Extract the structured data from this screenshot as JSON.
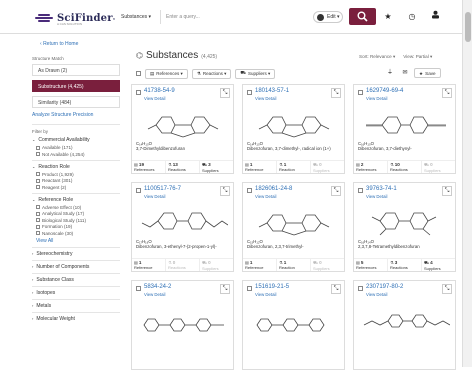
{
  "header": {
    "logo_text": "SciFinder",
    "logo_sup": "n",
    "logo_sub": "A CAS SOLUTION",
    "scope_label": "Substances ▾",
    "query_placeholder": "Enter a query...",
    "edit_label": "Edit ▾"
  },
  "nav": {
    "return_label": "Return to Home"
  },
  "sidebar": {
    "structure_match_heading": "Structure Match",
    "match_items": [
      {
        "label": "As Drawn (2)"
      },
      {
        "label": "Substructure (4,425)"
      },
      {
        "label": "Similarity (484)"
      }
    ],
    "analyze_link": "Analyze Structure Precision",
    "filter_heading": "Filter by",
    "sections": [
      {
        "title": "Commercial Availability",
        "options": [
          "Available (171)",
          "Not Available (4,254)"
        ]
      },
      {
        "title": "Reaction Role",
        "options": [
          "Product (1,929)",
          "Reactant (301)",
          "Reagent (2)"
        ]
      },
      {
        "title": "Reference Role",
        "options": [
          "Adverse Effect (10)",
          "Analytical Study (17)",
          "Biological Study (111)",
          "Formation (19)",
          "Nanoscale (30)"
        ]
      }
    ],
    "view_all": "View All",
    "collapsed": [
      "Stereochemistry",
      "Number of Components",
      "Substance Class",
      "Isotopes",
      "Metals",
      "Molecular Weight"
    ]
  },
  "main": {
    "title": "Substances",
    "count": "(4,425)",
    "sort_label": "Sort: Relevance ▾",
    "view_label": "View: Partial ▾",
    "toolbar": {
      "references": "References ▾",
      "reactions": "Reactions ▾",
      "suppliers": "Suppliers ▾",
      "save": "Save"
    }
  },
  "cards": [
    {
      "cas": "41738-54-9",
      "view": "View Detail",
      "formula": "C₁₄H₁₀O",
      "name": "3,7-Dimethyldibenzofuran",
      "refs": "19",
      "refs_label": "References",
      "rxns": "13",
      "rxns_label": "Reactions",
      "sup": "3",
      "sup_label": "Suppliers",
      "sup_dim": false,
      "mol": "dbf"
    },
    {
      "cas": "180143-57-1",
      "view": "View Detail",
      "formula": "C₁₄H₁₀O",
      "name": "Dibenzofuran, 3,7-dimethyl-, radical ion (1+)",
      "refs": "1",
      "refs_label": "Reference",
      "rxns": "1",
      "rxns_label": "Reaction",
      "sup": "0",
      "sup_label": "Suppliers",
      "sup_dim": true,
      "mol": "dbf"
    },
    {
      "cas": "1629749-69-4",
      "view": "View Detail",
      "formula": "C₁₆H₁₀O",
      "name": "Dibenzofuran, 3,7-diethynyl-",
      "refs": "2",
      "refs_label": "References",
      "rxns": "10",
      "rxns_label": "Reactions",
      "sup": "0",
      "sup_label": "Suppliers",
      "sup_dim": true,
      "mol": "ethynyl"
    },
    {
      "cas": "1100517-76-7",
      "view": "View Detail",
      "formula": "C₁₇H₁₆O",
      "name": "Dibenzofuran, 3-ethenyl-7-(2-propen-1-yl)-",
      "refs": "1",
      "refs_label": "Reference",
      "rxns": "0",
      "rxns_label": "Reactions",
      "sup": "0",
      "sup_label": "Suppliers",
      "sup_dim": true,
      "mol": "allyl"
    },
    {
      "cas": "1826061-24-8",
      "view": "View Detail",
      "formula": "C₁₅H₁₂O",
      "name": "Dibenzofuran, 2,3,7-trimethyl-",
      "refs": "1",
      "refs_label": "Reference",
      "rxns": "1",
      "rxns_label": "Reaction",
      "sup": "0",
      "sup_label": "Suppliers",
      "sup_dim": true,
      "mol": "dbf"
    },
    {
      "cas": "39763-74-1",
      "view": "View Detail",
      "formula": "C₁₆H₁₄O",
      "name": "2,3,7,8-Tetramethyldibenzofuran",
      "refs": "5",
      "refs_label": "References",
      "rxns": "3",
      "rxns_label": "Reactions",
      "sup": "4",
      "sup_label": "Suppliers",
      "sup_dim": false,
      "mol": "tetra"
    },
    {
      "cas": "5834-24-2",
      "view": "View Detail",
      "formula": "",
      "name": "",
      "refs": "",
      "refs_label": "",
      "rxns": "",
      "rxns_label": "",
      "sup": "",
      "sup_label": "",
      "sup_dim": true,
      "mol": "long"
    },
    {
      "cas": "151619-21-5",
      "view": "View Detail",
      "formula": "",
      "name": "",
      "refs": "",
      "refs_label": "",
      "rxns": "",
      "rxns_label": "",
      "sup": "",
      "sup_label": "",
      "sup_dim": true,
      "mol": "long2"
    },
    {
      "cas": "2307197-80-2",
      "view": "View Detail",
      "formula": "",
      "name": "",
      "refs": "",
      "refs_label": "",
      "rxns": "",
      "rxns_label": "",
      "sup": "",
      "sup_label": "",
      "sup_dim": true,
      "mol": "long3"
    }
  ]
}
